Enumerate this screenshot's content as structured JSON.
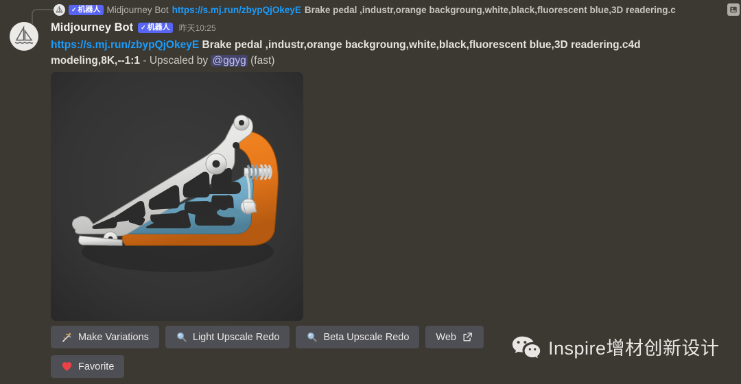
{
  "reply": {
    "author": "Midjourney Bot",
    "bot_badge": "机器人",
    "bot_badge_check": "✓",
    "link": "https://s.mj.run/zbypQjOkeyE",
    "text": "Brake pedal ,industr,orange backgroung,white,black,fluorescent blue,3D readering.c",
    "attachment_icon": "image-icon"
  },
  "message": {
    "author": "Midjourney Bot",
    "bot_badge": "机器人",
    "bot_badge_check": "✓",
    "timestamp": "昨天10:25",
    "link": "https://s.mj.run/zbypQjOkeyE",
    "prompt": "Brake pedal ,industr,orange backgroung,white,black,fluorescent blue,3D readering.c4d modeling,8K,--1:1",
    "separator": " - ",
    "action_text": "Upscaled by ",
    "mention": "@ggyg",
    "speed": " (fast)",
    "avatar_icon": "midjourney-sailboat-icon"
  },
  "attachment": {
    "alt": "3D rendered generative-design brake pedal, white lattice arm with orange and blue frame on dark background",
    "colors": {
      "background": "#343434",
      "white_part": "#e8e8e6",
      "orange_part": "#e8781c",
      "blue_part": "#6ea8c4",
      "dark_infill": "#2b2b2b"
    }
  },
  "buttons": {
    "row1": [
      {
        "label": "Make Variations",
        "icon": "magic-wand-icon"
      },
      {
        "label": "Light Upscale Redo",
        "icon": "magnifier-icon"
      },
      {
        "label": "Beta Upscale Redo",
        "icon": "magnifier-icon"
      },
      {
        "label": "Web",
        "icon": "external-link-icon",
        "icon_position": "right"
      }
    ],
    "row2": [
      {
        "label": "Favorite",
        "icon": "heart-icon"
      }
    ]
  },
  "watermark": {
    "text": "Inspire增材创新设计",
    "icon": "wechat-icon"
  },
  "theme": {
    "page_background": "#3c3832",
    "link_color": "#1b9dfc",
    "bot_badge_color": "#5865f2",
    "button_background": "#4e4e55",
    "heart_color": "#ed4245"
  }
}
